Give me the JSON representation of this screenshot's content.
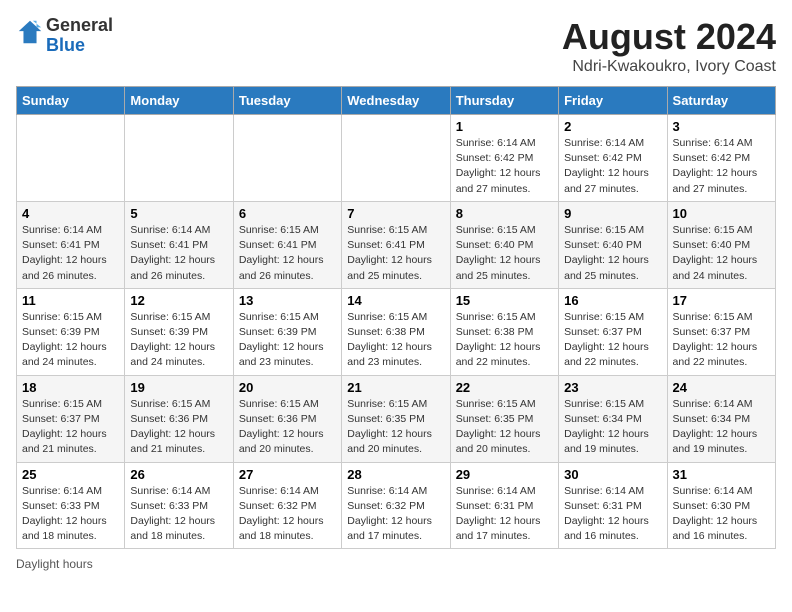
{
  "header": {
    "logo_general": "General",
    "logo_blue": "Blue",
    "month_year": "August 2024",
    "location": "Ndri-Kwakoukro, Ivory Coast"
  },
  "days_of_week": [
    "Sunday",
    "Monday",
    "Tuesday",
    "Wednesday",
    "Thursday",
    "Friday",
    "Saturday"
  ],
  "footer": {
    "note": "Daylight hours"
  },
  "weeks": [
    {
      "days": [
        {
          "num": "",
          "detail": ""
        },
        {
          "num": "",
          "detail": ""
        },
        {
          "num": "",
          "detail": ""
        },
        {
          "num": "",
          "detail": ""
        },
        {
          "num": "1",
          "detail": "Sunrise: 6:14 AM\nSunset: 6:42 PM\nDaylight: 12 hours\nand 27 minutes."
        },
        {
          "num": "2",
          "detail": "Sunrise: 6:14 AM\nSunset: 6:42 PM\nDaylight: 12 hours\nand 27 minutes."
        },
        {
          "num": "3",
          "detail": "Sunrise: 6:14 AM\nSunset: 6:42 PM\nDaylight: 12 hours\nand 27 minutes."
        }
      ]
    },
    {
      "days": [
        {
          "num": "4",
          "detail": "Sunrise: 6:14 AM\nSunset: 6:41 PM\nDaylight: 12 hours\nand 26 minutes."
        },
        {
          "num": "5",
          "detail": "Sunrise: 6:14 AM\nSunset: 6:41 PM\nDaylight: 12 hours\nand 26 minutes."
        },
        {
          "num": "6",
          "detail": "Sunrise: 6:15 AM\nSunset: 6:41 PM\nDaylight: 12 hours\nand 26 minutes."
        },
        {
          "num": "7",
          "detail": "Sunrise: 6:15 AM\nSunset: 6:41 PM\nDaylight: 12 hours\nand 25 minutes."
        },
        {
          "num": "8",
          "detail": "Sunrise: 6:15 AM\nSunset: 6:40 PM\nDaylight: 12 hours\nand 25 minutes."
        },
        {
          "num": "9",
          "detail": "Sunrise: 6:15 AM\nSunset: 6:40 PM\nDaylight: 12 hours\nand 25 minutes."
        },
        {
          "num": "10",
          "detail": "Sunrise: 6:15 AM\nSunset: 6:40 PM\nDaylight: 12 hours\nand 24 minutes."
        }
      ]
    },
    {
      "days": [
        {
          "num": "11",
          "detail": "Sunrise: 6:15 AM\nSunset: 6:39 PM\nDaylight: 12 hours\nand 24 minutes."
        },
        {
          "num": "12",
          "detail": "Sunrise: 6:15 AM\nSunset: 6:39 PM\nDaylight: 12 hours\nand 24 minutes."
        },
        {
          "num": "13",
          "detail": "Sunrise: 6:15 AM\nSunset: 6:39 PM\nDaylight: 12 hours\nand 23 minutes."
        },
        {
          "num": "14",
          "detail": "Sunrise: 6:15 AM\nSunset: 6:38 PM\nDaylight: 12 hours\nand 23 minutes."
        },
        {
          "num": "15",
          "detail": "Sunrise: 6:15 AM\nSunset: 6:38 PM\nDaylight: 12 hours\nand 22 minutes."
        },
        {
          "num": "16",
          "detail": "Sunrise: 6:15 AM\nSunset: 6:37 PM\nDaylight: 12 hours\nand 22 minutes."
        },
        {
          "num": "17",
          "detail": "Sunrise: 6:15 AM\nSunset: 6:37 PM\nDaylight: 12 hours\nand 22 minutes."
        }
      ]
    },
    {
      "days": [
        {
          "num": "18",
          "detail": "Sunrise: 6:15 AM\nSunset: 6:37 PM\nDaylight: 12 hours\nand 21 minutes."
        },
        {
          "num": "19",
          "detail": "Sunrise: 6:15 AM\nSunset: 6:36 PM\nDaylight: 12 hours\nand 21 minutes."
        },
        {
          "num": "20",
          "detail": "Sunrise: 6:15 AM\nSunset: 6:36 PM\nDaylight: 12 hours\nand 20 minutes."
        },
        {
          "num": "21",
          "detail": "Sunrise: 6:15 AM\nSunset: 6:35 PM\nDaylight: 12 hours\nand 20 minutes."
        },
        {
          "num": "22",
          "detail": "Sunrise: 6:15 AM\nSunset: 6:35 PM\nDaylight: 12 hours\nand 20 minutes."
        },
        {
          "num": "23",
          "detail": "Sunrise: 6:15 AM\nSunset: 6:34 PM\nDaylight: 12 hours\nand 19 minutes."
        },
        {
          "num": "24",
          "detail": "Sunrise: 6:14 AM\nSunset: 6:34 PM\nDaylight: 12 hours\nand 19 minutes."
        }
      ]
    },
    {
      "days": [
        {
          "num": "25",
          "detail": "Sunrise: 6:14 AM\nSunset: 6:33 PM\nDaylight: 12 hours\nand 18 minutes."
        },
        {
          "num": "26",
          "detail": "Sunrise: 6:14 AM\nSunset: 6:33 PM\nDaylight: 12 hours\nand 18 minutes."
        },
        {
          "num": "27",
          "detail": "Sunrise: 6:14 AM\nSunset: 6:32 PM\nDaylight: 12 hours\nand 18 minutes."
        },
        {
          "num": "28",
          "detail": "Sunrise: 6:14 AM\nSunset: 6:32 PM\nDaylight: 12 hours\nand 17 minutes."
        },
        {
          "num": "29",
          "detail": "Sunrise: 6:14 AM\nSunset: 6:31 PM\nDaylight: 12 hours\nand 17 minutes."
        },
        {
          "num": "30",
          "detail": "Sunrise: 6:14 AM\nSunset: 6:31 PM\nDaylight: 12 hours\nand 16 minutes."
        },
        {
          "num": "31",
          "detail": "Sunrise: 6:14 AM\nSunset: 6:30 PM\nDaylight: 12 hours\nand 16 minutes."
        }
      ]
    }
  ]
}
